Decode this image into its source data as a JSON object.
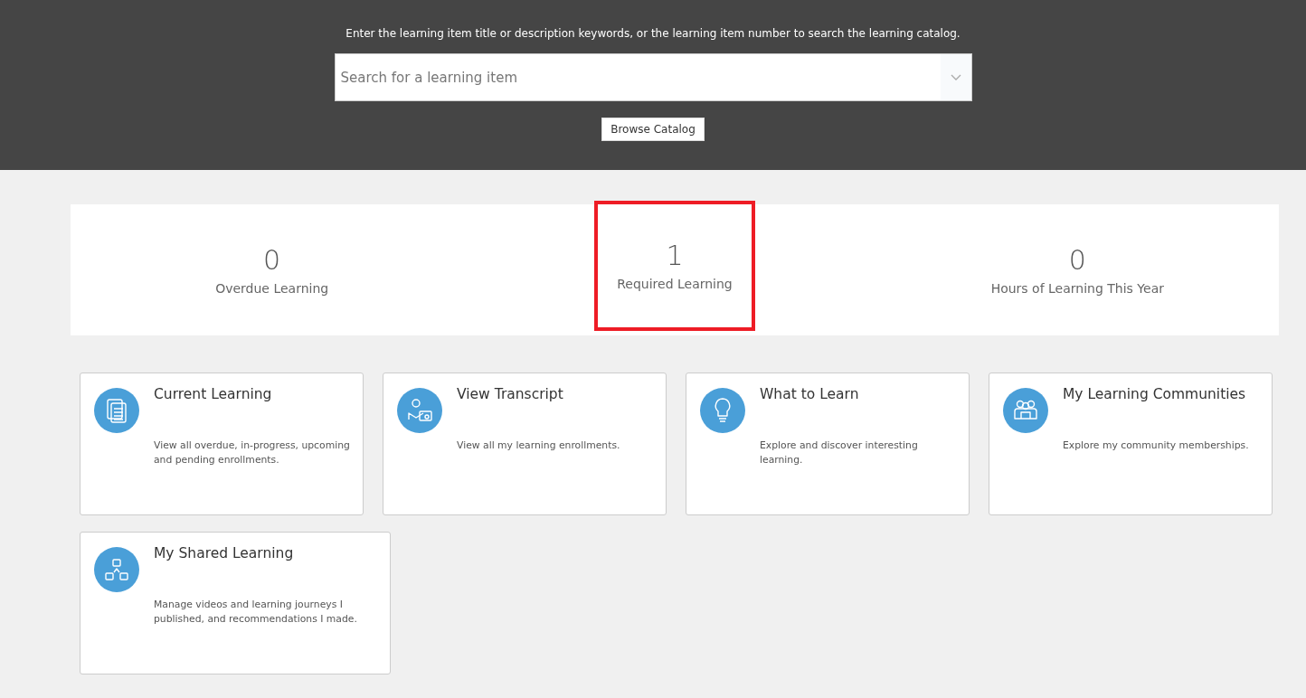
{
  "search": {
    "instructions": "Enter the learning item title or description keywords, or the learning item number to search the learning catalog.",
    "placeholder": "Search for a learning item",
    "button": "Browse Catalog"
  },
  "metrics": [
    {
      "value": "0",
      "label": "Overdue Learning",
      "highlighted": false
    },
    {
      "value": "1",
      "label": "Required Learning",
      "highlighted": true
    },
    {
      "value": "0",
      "label": "Hours of Learning This Year",
      "highlighted": false
    }
  ],
  "cards": [
    {
      "kind": "documents",
      "title": "Current Learning",
      "description": "View all overdue, in-progress, upcoming and pending enrollments."
    },
    {
      "kind": "transcript",
      "title": "View Transcript",
      "description": "View all my learning enrollments."
    },
    {
      "kind": "lightbulb",
      "title": "What to Learn",
      "description": "Explore and discover interesting learning."
    },
    {
      "kind": "community",
      "title": "My Learning Communities",
      "description": "Explore my community memberships."
    },
    {
      "kind": "shared",
      "title": "My Shared Learning",
      "description": "Manage videos and learning journeys I published, and recommendations I made."
    }
  ]
}
